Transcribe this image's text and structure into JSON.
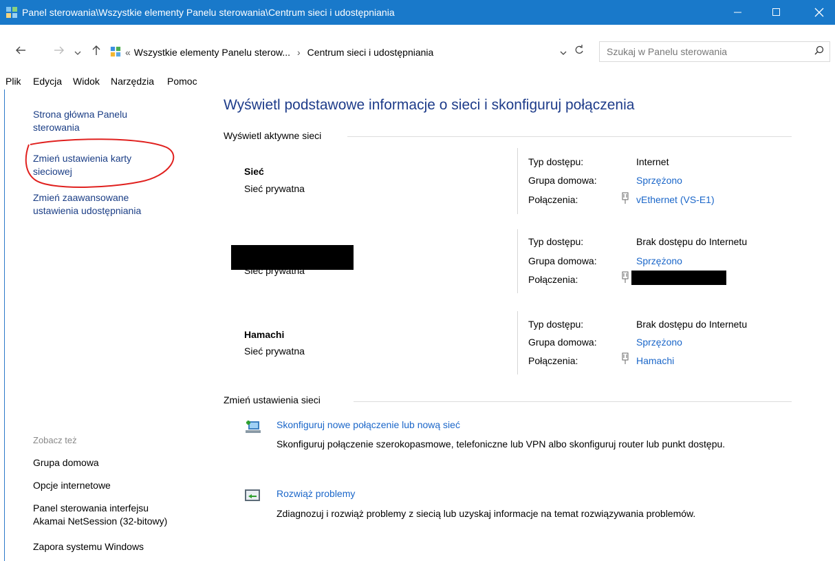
{
  "window": {
    "title": "Panel sterowania\\Wszystkie elementy Panelu sterowania\\Centrum sieci i udostępniania",
    "minimize_icon": "minimize-icon",
    "maximize_icon": "maximize-icon",
    "close_icon": "close-icon",
    "title_bar_color": "#1979ca"
  },
  "address": {
    "prefix": "«",
    "crumb1": "Wszystkie elementy Panelu sterow...",
    "sep": "›",
    "crumb2": "Centrum sieci i udostępniania",
    "search_placeholder": "Szukaj w Panelu sterowania"
  },
  "menu": [
    "Plik",
    "Edycja",
    "Widok",
    "Narzędzia",
    "Pomoc"
  ],
  "sidebar": {
    "home_line1": "Strona główna Panelu",
    "home_line2": "sterowania",
    "adapter_line1": "Zmień ustawienia karty",
    "adapter_line2": "sieciowej",
    "sharing_line1": "Zmień zaawansowane",
    "sharing_line2": "ustawienia udostępniania",
    "see_also": "Zobacz też",
    "links": [
      "Grupa domowa",
      "Opcje internetowe",
      "Panel sterowania interfejsu",
      "Akamai NetSession (32-bitowy)",
      "Zapora systemu Windows"
    ]
  },
  "main": {
    "heading": "Wyświetl podstawowe informacje o sieci i skonfiguruj połączenia",
    "active_networks_label": "Wyświetl aktywne sieci",
    "labels": {
      "access": "Typ dostępu:",
      "homegroup": "Grupa domowa:",
      "connections": "Połączenia:"
    },
    "networks": [
      {
        "name": "Sieć",
        "type": "Sieć prywatna",
        "access": "Internet",
        "homegroup": "Sprzężono",
        "connection": "vEthernet (VS-E1)"
      },
      {
        "name": "",
        "type": "Sieć prywatna",
        "access": "Brak dostępu do Internetu",
        "homegroup": "Sprzężono",
        "connection": ""
      },
      {
        "name": "Hamachi",
        "type": "Sieć prywatna",
        "access": "Brak dostępu do Internetu",
        "homegroup": "Sprzężono",
        "connection": "Hamachi"
      }
    ],
    "change_settings_label": "Zmień ustawienia sieci",
    "tasks": [
      {
        "title": "Skonfiguruj nowe połączenie lub nową sieć",
        "desc": "Skonfiguruj połączenie szerokopasmowe, telefoniczne lub VPN albo skonfiguruj router lub punkt dostępu."
      },
      {
        "title": "Rozwiąż problemy",
        "desc": "Zdiagnozuj i rozwiąż problemy z siecią lub uzyskaj informacje na temat rozwiązywania problemów."
      }
    ]
  },
  "colors": {
    "link": "#1a66c9",
    "heading": "#1e3c8a",
    "annotation": "#e0201e"
  }
}
